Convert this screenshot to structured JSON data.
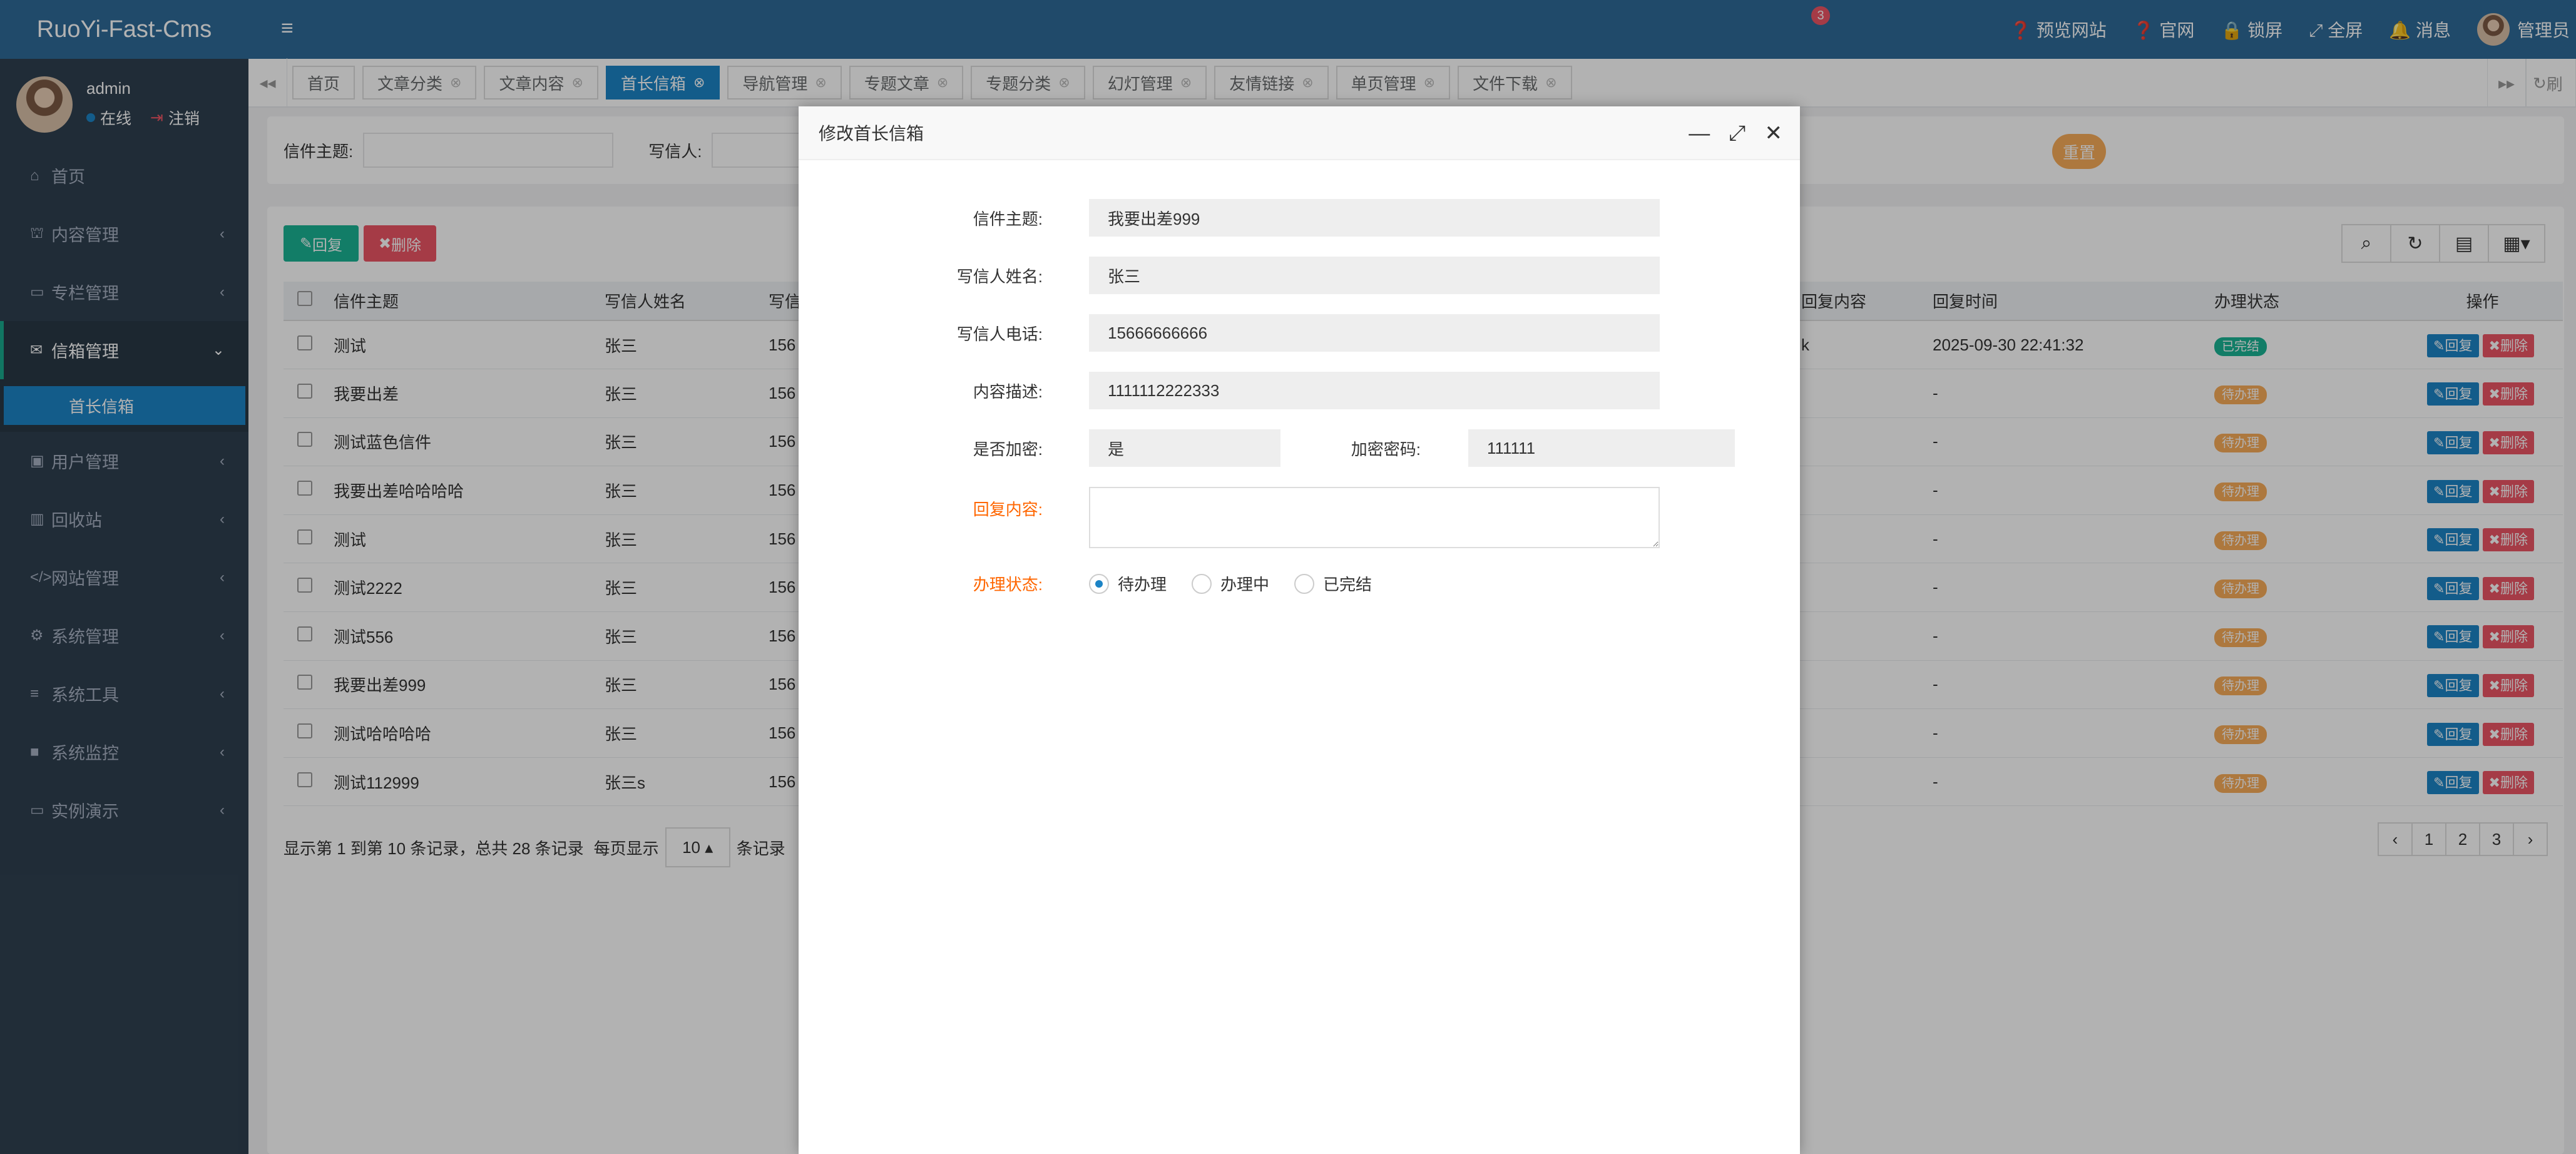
{
  "app": {
    "brand": "RuoYi-Fast-Cms"
  },
  "user": {
    "name": "admin",
    "online": "在线",
    "logout": "注销"
  },
  "sidebar": {
    "items": [
      {
        "label": "首页",
        "icon": "home-icon"
      },
      {
        "label": "内容管理",
        "icon": "bank-icon"
      },
      {
        "label": "专栏管理",
        "icon": "calendar-icon"
      },
      {
        "label": "信箱管理",
        "icon": "envelope-open-icon"
      },
      {
        "label": "用户管理",
        "icon": "user-card-icon"
      },
      {
        "label": "回收站",
        "icon": "bar-chart-icon"
      },
      {
        "label": "网站管理",
        "icon": "code-icon"
      },
      {
        "label": "系统管理",
        "icon": "gear-icon"
      },
      {
        "label": "系统工具",
        "icon": "bars-icon"
      },
      {
        "label": "系统监控",
        "icon": "video-icon"
      },
      {
        "label": "实例演示",
        "icon": "desktop-icon"
      }
    ],
    "sub_active": "首长信箱"
  },
  "topbar": {
    "preview": "预览网站",
    "official": "官网",
    "lock": "锁屏",
    "fullscreen": "全屏",
    "messages": "消息",
    "message_count": "3",
    "admin": "管理员"
  },
  "tabs": [
    {
      "label": "首页",
      "closable": false
    },
    {
      "label": "文章分类",
      "closable": true
    },
    {
      "label": "文章内容",
      "closable": true
    },
    {
      "label": "首长信箱",
      "closable": true,
      "active": true
    },
    {
      "label": "导航管理",
      "closable": true
    },
    {
      "label": "专题文章",
      "closable": true
    },
    {
      "label": "专题分类",
      "closable": true
    },
    {
      "label": "幻灯管理",
      "closable": true
    },
    {
      "label": "友情链接",
      "closable": true
    },
    {
      "label": "单页管理",
      "closable": true
    },
    {
      "label": "文件下载",
      "closable": true
    }
  ],
  "tabs_right": {
    "refresh": "刷"
  },
  "search": {
    "subject_label": "信件主题:",
    "writer_label": "写信人:",
    "reset": "重置"
  },
  "toolbar": {
    "reply": "回复",
    "delete": "删除"
  },
  "table": {
    "headers": [
      "信件主题",
      "写信人姓名",
      "写信",
      "回复内容",
      "回复时间",
      "办理状态",
      "操作"
    ],
    "rows": [
      {
        "subject": "测试",
        "writer": "张三",
        "phone": "156",
        "reply": "k",
        "time": "2025-09-30 22:41:32",
        "status": "已完结",
        "done": true
      },
      {
        "subject": "我要出差",
        "writer": "张三",
        "phone": "156",
        "reply": "",
        "time": "-",
        "status": "待办理",
        "done": false
      },
      {
        "subject": "测试蓝色信件",
        "writer": "张三",
        "phone": "156",
        "reply": "",
        "time": "-",
        "status": "待办理",
        "done": false
      },
      {
        "subject": "我要出差哈哈哈哈",
        "writer": "张三",
        "phone": "156",
        "reply": "",
        "time": "-",
        "status": "待办理",
        "done": false
      },
      {
        "subject": "测试",
        "writer": "张三",
        "phone": "156",
        "reply": "",
        "time": "-",
        "status": "待办理",
        "done": false
      },
      {
        "subject": "测试2222",
        "writer": "张三",
        "phone": "156",
        "reply": "",
        "time": "-",
        "status": "待办理",
        "done": false
      },
      {
        "subject": "测试556",
        "writer": "张三",
        "phone": "156",
        "reply": "",
        "time": "-",
        "status": "待办理",
        "done": false
      },
      {
        "subject": "我要出差999",
        "writer": "张三",
        "phone": "156",
        "reply": "",
        "time": "-",
        "status": "待办理",
        "done": false
      },
      {
        "subject": "测试哈哈哈哈",
        "writer": "张三",
        "phone": "156",
        "reply": "",
        "time": "-",
        "status": "待办理",
        "done": false
      },
      {
        "subject": "测试112999",
        "writer": "张三s",
        "phone": "156",
        "reply": "",
        "time": "-",
        "status": "待办理",
        "done": false
      }
    ],
    "row_reply": "回复",
    "row_delete": "删除"
  },
  "pagination": {
    "info": "显示第 1 到第 10 条记录，总共 28 条记录",
    "per_page_prefix": "每页显示",
    "per_page": "10",
    "per_page_suffix": "条记录",
    "pages": [
      "‹",
      "1",
      "2",
      "3",
      "›"
    ]
  },
  "modal": {
    "title": "修改首长信箱",
    "fields": {
      "subject_label": "信件主题:",
      "subject": "我要出差999",
      "writer_label": "写信人姓名:",
      "writer": "张三",
      "phone_label": "写信人电话:",
      "phone": "15666666666",
      "desc_label": "内容描述:",
      "desc": "1111112222333",
      "encrypt_label": "是否加密:",
      "encrypt": "是",
      "password_label": "加密密码:",
      "password": "111111",
      "reply_label": "回复内容:",
      "reply": "",
      "status_label": "办理状态:",
      "status_options": [
        "待办理",
        "办理中",
        "已完结"
      ],
      "status_selected": 0
    }
  },
  "colors": {
    "topbar": "#2f6b98",
    "sidebar": "#2f4050",
    "primary": "#1c84c6",
    "success": "#1ab394",
    "warning": "#f8ac59",
    "danger": "#ed5565",
    "required": "#ff6600"
  }
}
